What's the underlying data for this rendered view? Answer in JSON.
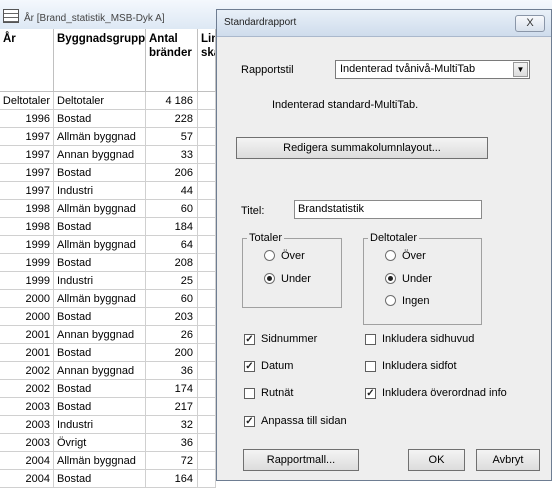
{
  "table_window": {
    "title": "År [Brand_statistik_MSB-Dyk A]",
    "headers": {
      "year": "År",
      "building_type": "Byggnadsgrupp",
      "count": "Antal\nbränder",
      "extra": "Lin\nska"
    },
    "rows": [
      {
        "year": "Deltotaler",
        "type": "Deltotaler",
        "count": "4 186"
      },
      {
        "year": "1996",
        "type": "Bostad",
        "count": "228"
      },
      {
        "year": "1997",
        "type": "Allmän byggnad",
        "count": "57"
      },
      {
        "year": "1997",
        "type": "Annan byggnad",
        "count": "33"
      },
      {
        "year": "1997",
        "type": "Bostad",
        "count": "206"
      },
      {
        "year": "1997",
        "type": "Industri",
        "count": "44"
      },
      {
        "year": "1998",
        "type": "Allmän byggnad",
        "count": "60"
      },
      {
        "year": "1998",
        "type": "Bostad",
        "count": "184"
      },
      {
        "year": "1999",
        "type": "Allmän byggnad",
        "count": "64"
      },
      {
        "year": "1999",
        "type": "Bostad",
        "count": "208"
      },
      {
        "year": "1999",
        "type": "Industri",
        "count": "25"
      },
      {
        "year": "2000",
        "type": "Allmän byggnad",
        "count": "60"
      },
      {
        "year": "2000",
        "type": "Bostad",
        "count": "203"
      },
      {
        "year": "2001",
        "type": "Annan byggnad",
        "count": "26"
      },
      {
        "year": "2001",
        "type": "Bostad",
        "count": "200"
      },
      {
        "year": "2002",
        "type": "Annan byggnad",
        "count": "36"
      },
      {
        "year": "2002",
        "type": "Bostad",
        "count": "174"
      },
      {
        "year": "2003",
        "type": "Bostad",
        "count": "217"
      },
      {
        "year": "2003",
        "type": "Industri",
        "count": "32"
      },
      {
        "year": "2003",
        "type": "Övrigt",
        "count": "36"
      },
      {
        "year": "2004",
        "type": "Allmän byggnad",
        "count": "72"
      },
      {
        "year": "2004",
        "type": "Bostad",
        "count": "164"
      }
    ]
  },
  "dialog": {
    "title": "Standardrapport",
    "close_label": "X",
    "report_style_label": "Rapportstil",
    "report_style_value": "Indenterad tvånivå-MultiTab",
    "report_style_description": "Indenterad standard-MultiTab.",
    "edit_summary_button": "Redigera summakolumnlayout...",
    "title_label": "Titel:",
    "title_value": "Brandstatistik",
    "totals_group": {
      "legend": "Totaler",
      "options": [
        "Över",
        "Under"
      ],
      "selected": "Under"
    },
    "subtotals_group": {
      "legend": "Deltotaler",
      "options": [
        "Över",
        "Under",
        "Ingen"
      ],
      "selected": "Under"
    },
    "checkboxes": {
      "page_numbers": {
        "label": "Sidnummer",
        "checked": true
      },
      "date": {
        "label": "Datum",
        "checked": true
      },
      "gridlines": {
        "label": "Rutnät",
        "checked": false
      },
      "fit_to_page": {
        "label": "Anpassa till sidan",
        "checked": true
      },
      "include_header": {
        "label": "Inkludera sidhuvud",
        "checked": false
      },
      "include_footer": {
        "label": "Inkludera sidfot",
        "checked": false
      },
      "include_parent_info": {
        "label": "Inkludera överordnad info",
        "checked": true
      }
    },
    "buttons": {
      "report_template": "Rapportmall...",
      "ok": "OK",
      "cancel": "Avbryt"
    }
  }
}
